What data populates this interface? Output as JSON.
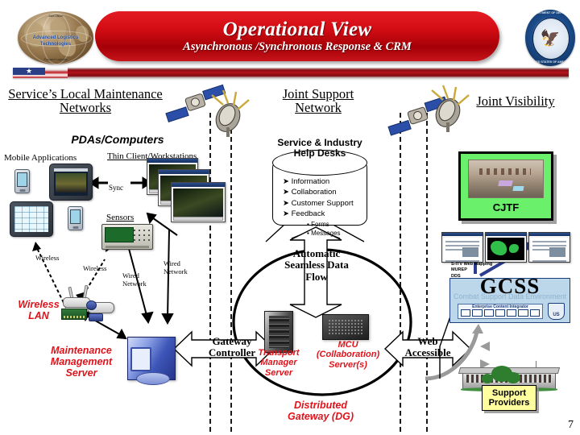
{
  "header": {
    "title": "Operational View",
    "subtitle": "Asynchronous /Synchronous Response & CRM",
    "left_logo_text": "Advanced Logistics Technologies",
    "left_logo_top": "Joint Vision",
    "left_logo_bottom": "Focused Logistics",
    "seal_top_text": "DEPARTMENT OF DEFENSE",
    "seal_bottom_text": "UNITED STATES OF AMERICA"
  },
  "sections": {
    "left_title": "Service’s Local Maintenance Networks",
    "center_title": "Joint Support Network",
    "right_title": "Joint Visibility"
  },
  "left": {
    "pdas_computers": "PDAs/Computers",
    "mobile_applications": "Mobile Applications",
    "thin_client": "Thin Client/Workstations",
    "sync": "Sync",
    "sensors": "Sensors",
    "wireless_1": "Wireless",
    "wireless_2": "Wireless",
    "wired_network_1": "Wired Network",
    "wired_network_2": "Wired Network",
    "wireless_lan": "Wireless LAN",
    "maintenance_server": "Maintenance Management Server"
  },
  "center": {
    "helpdesk_title": "Service & Industry Help Desks",
    "helpdesk_items": [
      "Information",
      "Collaboration",
      "Customer Support",
      "Feedback"
    ],
    "helpdesk_subitems": [
      "Forms",
      "Messages"
    ],
    "data_flow": "Automatic Seamless Data Flow",
    "gateway_controller": "Gateway Controller",
    "transport_manager": "Transport Manager Server",
    "mcu": "MCU (Collaboration) Server(s)",
    "distributed_gateway": "Distributed Gateway (DG)",
    "web_accessible": "Web Accessible"
  },
  "right": {
    "cjtf_label": "CJTF",
    "gcss_title": "GCSS",
    "gcss_subtitle": "Combat Support Data Environment",
    "gcss_strip_label": "Enterprise Content Integrator",
    "gcss_shield_label": "US",
    "gcss_note": "S-ITV Web Mapping\nMUREP\nDDS",
    "support_providers": "Support Providers"
  },
  "footer": {
    "page_number": "7"
  },
  "colors": {
    "banner_red": "#d40d14",
    "accent_red_text": "#e0121a",
    "cjtf_green": "#6bf06b",
    "gcss_blue": "#bcd7ea",
    "support_yellow": "#ffff9e",
    "seal_blue": "#123968"
  }
}
